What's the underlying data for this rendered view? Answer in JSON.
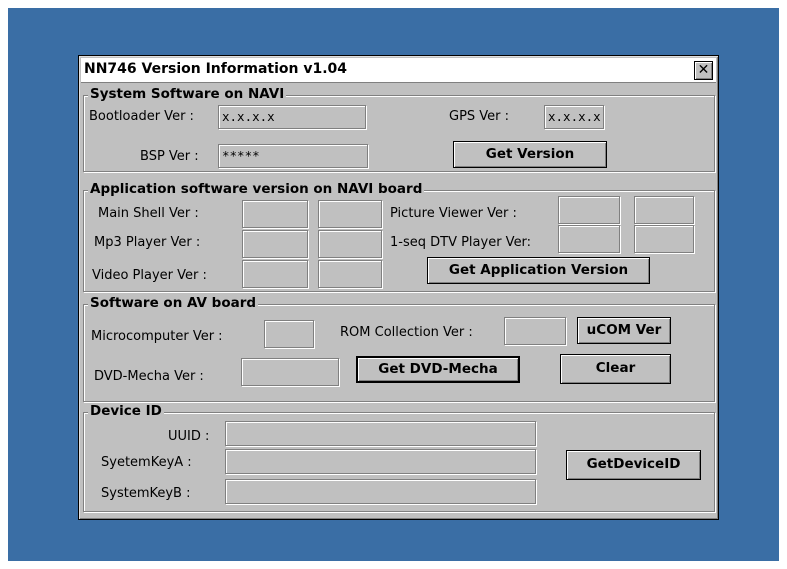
{
  "window": {
    "title": "NN746 Version Information v1.04",
    "close_label": "✕"
  },
  "system_software": {
    "title": "System Software on NAVI",
    "bootloader_label": "Bootloader Ver :",
    "bootloader_value": "x.x.x.x",
    "gps_label": "GPS Ver :",
    "gps_value": "x.x.x.x",
    "bsp_label": "BSP Ver :",
    "bsp_value": "*****",
    "get_version_label": "Get Version"
  },
  "application_software": {
    "title": "Application software version on NAVI board",
    "main_shell_label": "Main Shell Ver :",
    "mp3_player_label": "Mp3 Player Ver :",
    "video_player_label": "Video Player Ver :",
    "picture_viewer_label": "Picture Viewer Ver :",
    "dtv_player_label": "1-seq DTV Player Ver:",
    "get_app_version_label": "Get Application Version"
  },
  "av_board": {
    "title": "Software on AV board",
    "microcomputer_label": "Microcomputer Ver :",
    "rom_collection_label": "ROM Collection Ver :",
    "ucom_ver_label": "uCOM Ver",
    "dvd_mecha_label": "DVD-Mecha Ver :",
    "get_dvd_mecha_label": "Get DVD-Mecha",
    "clear_label": "Clear"
  },
  "device_id": {
    "title": "Device ID",
    "uuid_label": "UUID :",
    "key_a_label": "SyetemKeyA :",
    "key_b_label": "SystemKeyB :",
    "get_device_id_label": "GetDeviceID"
  }
}
